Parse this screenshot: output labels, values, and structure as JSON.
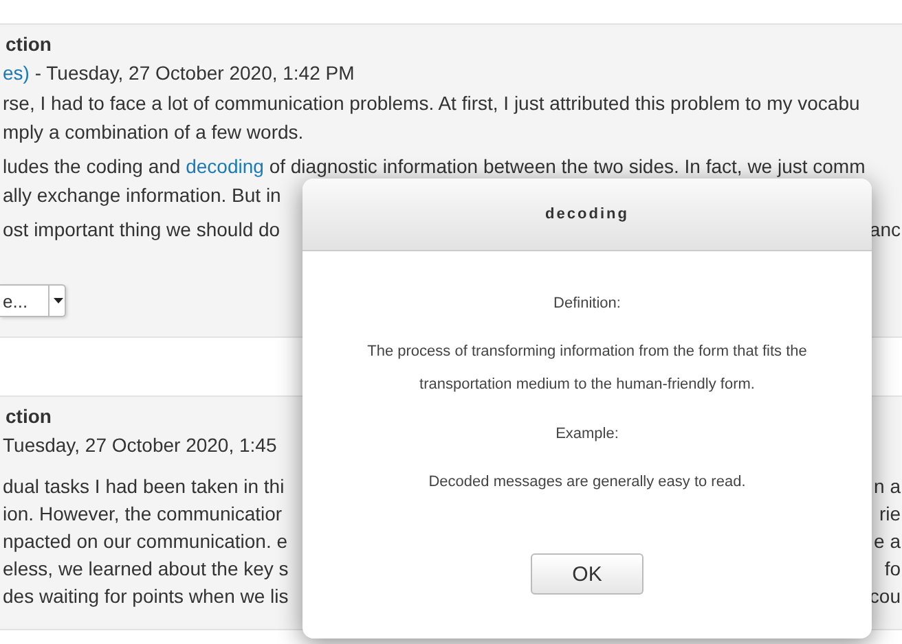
{
  "posts": [
    {
      "title": "ction",
      "meta": {
        "author_link": "es)",
        "date": " - Tuesday, 27 October 2020, 1:42 PM"
      },
      "paragraphs": [
        [
          {
            "left": [
              {
                "text": "rse, I had to face a lot of communication problems. At first, I just attributed this problem to my vocabu",
                "link": false
              }
            ]
          },
          {
            "left": [
              {
                "text": "mply a combination of a few words.",
                "link": false
              }
            ]
          }
        ],
        [
          {
            "left": [
              {
                "text": "ludes the coding and ",
                "link": false
              },
              {
                "text": "decoding",
                "link": true
              },
              {
                "text": " of diagnostic information between the two sides. In fact, we just comm",
                "link": false
              }
            ]
          },
          {
            "left": [
              {
                "text": "ally exchange information. But in",
                "link": false
              }
            ]
          }
        ],
        [
          {
            "left": [
              {
                "text": "ost important thing we should do",
                "link": false
              }
            ],
            "right": "anc"
          }
        ]
      ],
      "select": {
        "value": "e..."
      }
    },
    {
      "title": "ction",
      "meta": {
        "date": "Tuesday, 27 October 2020, 1:45 "
      },
      "paragraphs": [
        [
          {
            "left": [
              {
                "text": "dual tasks I had been taken in thi",
                "link": false
              }
            ],
            "right": "n a"
          },
          {
            "left": [
              {
                "text": "ion. However, the communicatior",
                "link": false
              }
            ],
            "right": "rie"
          },
          {
            "left": [
              {
                "text": "npacted on our communication. e",
                "link": false
              }
            ],
            "right": "e a"
          },
          {
            "left": [
              {
                "text": "eless, we learned about the key s",
                "link": false
              }
            ],
            "right": "fo"
          },
          {
            "left": [
              {
                "text": "des waiting for points when we lis",
                "link": false
              }
            ],
            "right": "cou"
          }
        ]
      ]
    }
  ],
  "dialog": {
    "title": "decoding",
    "sections": [
      {
        "kind": "label",
        "text": "Definition:"
      },
      {
        "kind": "body",
        "text": "The process of transforming information from the form that fits the transportation medium to the human-friendly form."
      },
      {
        "kind": "label",
        "text": "Example:"
      },
      {
        "kind": "body",
        "text": "Decoded messages are generally easy to read."
      }
    ],
    "button": "OK"
  }
}
